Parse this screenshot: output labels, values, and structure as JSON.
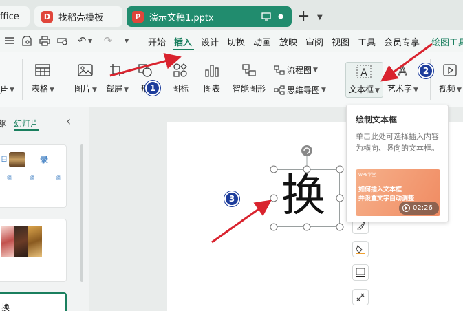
{
  "tabs": {
    "wps_label": "ffice",
    "template_label": "找稻壳模板",
    "doc_label": "演示文稿1.pptx",
    "new_tab": "+"
  },
  "menu": {
    "items": [
      "开始",
      "插入",
      "设计",
      "切换",
      "动画",
      "放映",
      "审阅",
      "视图",
      "工具",
      "会员专享",
      "绘图工具"
    ],
    "active": "插入"
  },
  "ribbon": {
    "partial_left": "片",
    "table": "表格",
    "picture": "图片",
    "screenshot": "截屏",
    "shape": "形",
    "icon": "图标",
    "chart": "图表",
    "smartart": "智能图形",
    "flowchart": "流程图",
    "mindmap": "思维导图",
    "textbox": "文本框",
    "wordart": "艺术字",
    "video": "视频"
  },
  "panel": {
    "outline_tab": "纲",
    "slides_tab": "幻灯片",
    "collapse": "‹",
    "slide1_text": [
      "目",
      "录"
    ],
    "slide1_sub": [
      "疆",
      "疆",
      "疆",
      "疆"
    ],
    "slide3_text": "换"
  },
  "canvas": {
    "textbox_content": "换"
  },
  "tooltip": {
    "title": "绘制文本框",
    "desc": "单击此处可选择插入内容为横向、竖向的文本框。",
    "video_tag": "WPS学堂",
    "video_title": "如何插入文本框",
    "video_sub": "并设置文字自动调整",
    "duration": "02:26"
  },
  "annotations": {
    "badge1": "1",
    "badge2": "2",
    "badge3": "3"
  },
  "colors": {
    "accent": "#1a7f5e",
    "doc_tab": "#218c6e",
    "arrow": "#d9232e",
    "badge": "#1d3d9c"
  }
}
